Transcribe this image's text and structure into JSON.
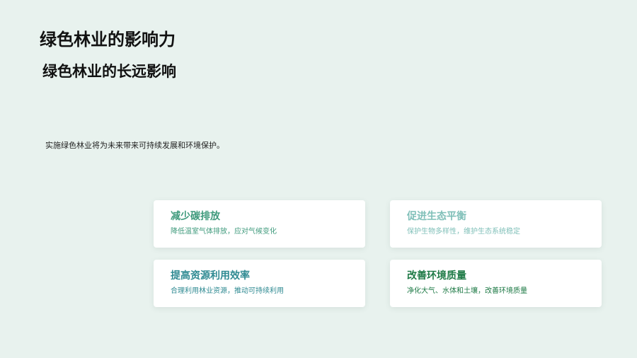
{
  "title": "绿色林业的影响力",
  "subtitle": "绿色林业的长远影响",
  "intro": "实施绿色林业将为未来带来可持续发展和环境保护。",
  "cards": [
    {
      "title": "减少碳排放",
      "description": "降低温室气体排放，应对气候变化",
      "title_color": "#3f9a7c",
      "desc_color": "#3f9a7c"
    },
    {
      "title": "促进生态平衡",
      "description": "保护生物多样性，维护生态系统稳定",
      "title_color": "#7fbfb8",
      "desc_color": "#7fbfb8"
    },
    {
      "title": "提高资源利用效率",
      "description": "合理利用林业资源，推动可持续利用",
      "title_color": "#2f8a92",
      "desc_color": "#2f8a92"
    },
    {
      "title": "改善环境质量",
      "description": "净化大气、水体和土壤，改善环境质量",
      "title_color": "#1e7a46",
      "desc_color": "#1e7a46"
    }
  ]
}
